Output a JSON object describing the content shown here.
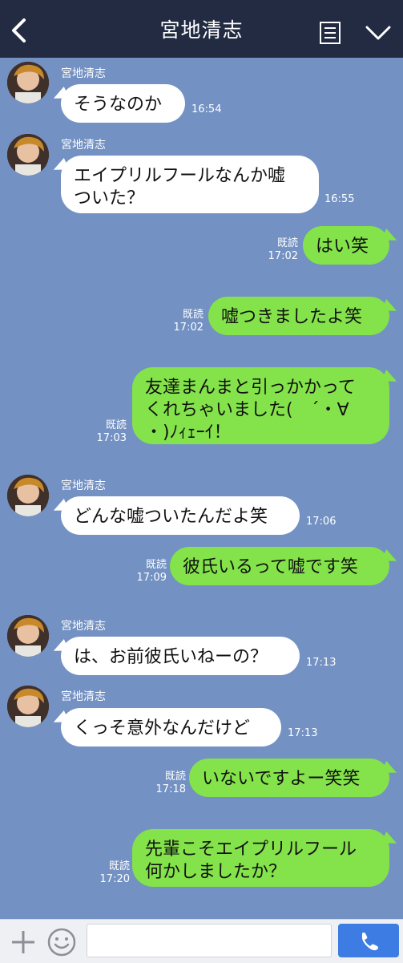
{
  "header": {
    "title": "宮地清志"
  },
  "messages": [
    {
      "side": "in",
      "sender": "宮地清志",
      "text": "そうなのか",
      "time": "16:54"
    },
    {
      "side": "in",
      "sender": "宮地清志",
      "text": "エイプリルフールなんか嘘\nついた？",
      "time": "16:55"
    },
    {
      "side": "out",
      "read": "既読",
      "text": "はい笑",
      "time": "17:02"
    },
    {
      "side": "out",
      "read": "既読",
      "text": "嘘つきましたよ笑",
      "time": "17:02"
    },
    {
      "side": "out",
      "read": "既読",
      "text": "友達まんまと引っかかって\nくれちゃいました(　´・∀\n・)ﾉｨｪｰｲ！",
      "time": "17:03"
    },
    {
      "side": "in",
      "sender": "宮地清志",
      "text": "どんな嘘ついたんだよ笑",
      "time": "17:06"
    },
    {
      "side": "out",
      "read": "既読",
      "text": "彼氏いるって嘘です笑",
      "time": "17:09"
    },
    {
      "side": "in",
      "sender": "宮地清志",
      "text": "は、お前彼氏いねーの？",
      "time": "17:13"
    },
    {
      "side": "in",
      "sender": "宮地清志",
      "text": "くっそ意外なんだけど",
      "time": "17:13"
    },
    {
      "side": "out",
      "read": "既読",
      "text": "いないですよー笑笑",
      "time": "17:18"
    },
    {
      "side": "out",
      "read": "既読",
      "text": "先輩こそエイプリルフール\n何かしましたか？",
      "time": "17:20"
    }
  ],
  "footer": {
    "input_placeholder": ""
  }
}
